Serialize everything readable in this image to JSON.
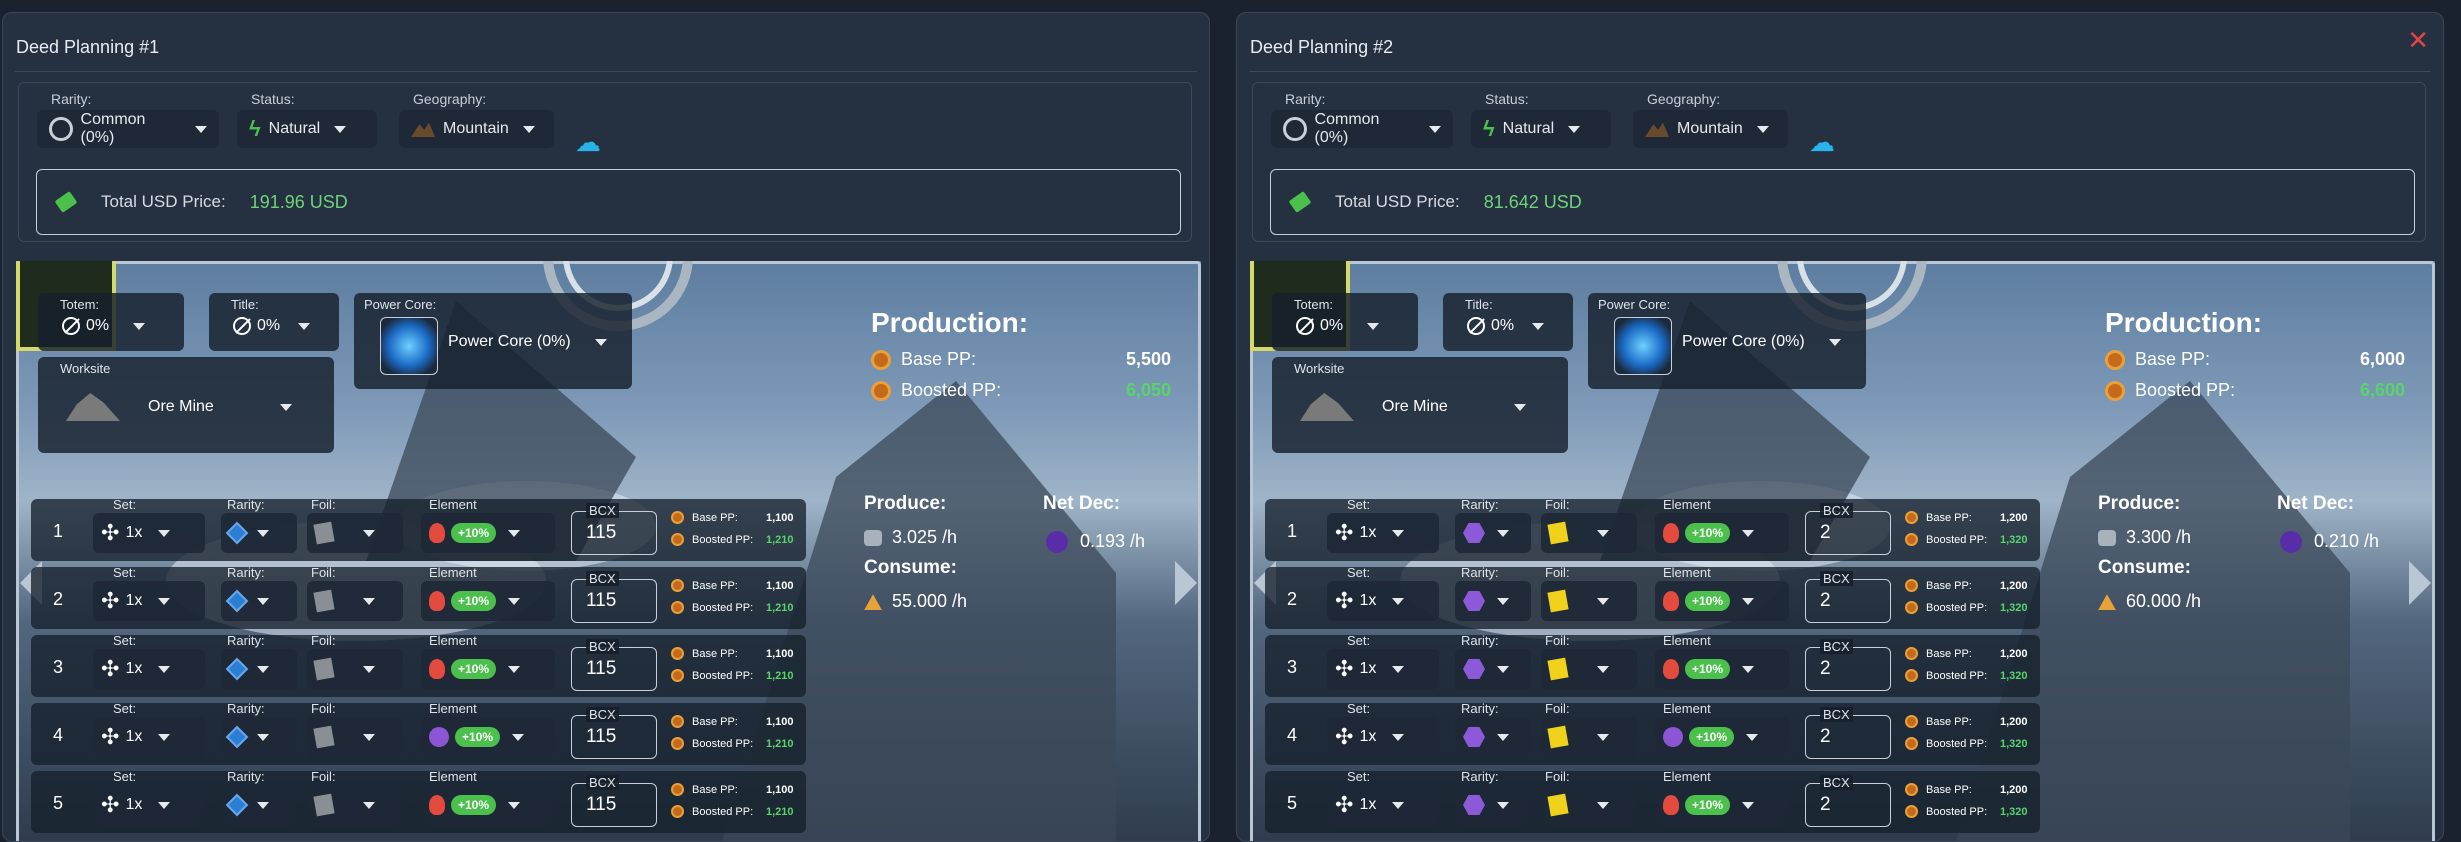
{
  "panels": [
    {
      "title": "Deed Planning #1",
      "show_close": false,
      "filters": {
        "rarity_label": "Rarity:",
        "rarity": "Common (0%)",
        "status_label": "Status:",
        "status": "Natural",
        "geography_label": "Geography:",
        "geography": "Mountain"
      },
      "price": {
        "label": "Total USD Price:",
        "value": "191.96 USD"
      },
      "stats": {
        "totem_label": "Totem:",
        "totem": "0%",
        "title_label": "Title:",
        "title": "0%",
        "power_core_label": "Power Core:",
        "power_core": "Power Core (0%)",
        "worksite_label": "Worksite",
        "worksite": "Ore Mine"
      },
      "production": {
        "title": "Production:",
        "base_label": "Base PP:",
        "base": "5,500",
        "boosted_label": "Boosted PP:",
        "boosted": "6,050"
      },
      "produce": {
        "label": "Produce:",
        "value": "3.025 /h"
      },
      "consume": {
        "label": "Consume:",
        "value": "55.000 /h"
      },
      "netdec": {
        "label": "Net Dec:",
        "value": "0.193 /h"
      },
      "card_labels": {
        "set": "Set:",
        "rarity": "Rarity:",
        "foil": "Foil:",
        "element": "Element",
        "bcx": "BCX",
        "base_pp": "Base PP:",
        "boosted_pp": "Boosted PP:"
      },
      "rows": [
        {
          "n": "1",
          "set": "1x",
          "element_icon": "fire-icon",
          "boost": "+10%",
          "bcx": "115",
          "base": "1,100",
          "boosted": "1,210"
        },
        {
          "n": "2",
          "set": "1x",
          "element_icon": "fire-icon",
          "boost": "+10%",
          "bcx": "115",
          "base": "1,100",
          "boosted": "1,210"
        },
        {
          "n": "3",
          "set": "1x",
          "element_icon": "fire-icon",
          "boost": "+10%",
          "bcx": "115",
          "base": "1,100",
          "boosted": "1,210"
        },
        {
          "n": "4",
          "set": "1x",
          "element_icon": "death-icon",
          "boost": "+10%",
          "bcx": "115",
          "base": "1,100",
          "boosted": "1,210"
        },
        {
          "n": "5",
          "set": "1x",
          "element_icon": "fire-icon",
          "boost": "+10%",
          "bcx": "115",
          "base": "1,100",
          "boosted": "1,210"
        }
      ]
    },
    {
      "title": "Deed Planning #2",
      "show_close": true,
      "close": "✕",
      "filters": {
        "rarity_label": "Rarity:",
        "rarity": "Common (0%)",
        "status_label": "Status:",
        "status": "Natural",
        "geography_label": "Geography:",
        "geography": "Mountain"
      },
      "price": {
        "label": "Total USD Price:",
        "value": "81.642 USD"
      },
      "stats": {
        "totem_label": "Totem:",
        "totem": "0%",
        "title_label": "Title:",
        "title": "0%",
        "power_core_label": "Power Core:",
        "power_core": "Power Core (0%)",
        "worksite_label": "Worksite",
        "worksite": "Ore Mine"
      },
      "production": {
        "title": "Production:",
        "base_label": "Base PP:",
        "base": "6,000",
        "boosted_label": "Boosted PP:",
        "boosted": "6,600"
      },
      "produce": {
        "label": "Produce:",
        "value": "3.300 /h"
      },
      "consume": {
        "label": "Consume:",
        "value": "60.000 /h"
      },
      "netdec": {
        "label": "Net Dec:",
        "value": "0.210 /h"
      },
      "card_labels": {
        "set": "Set:",
        "rarity": "Rarity:",
        "foil": "Foil:",
        "element": "Element",
        "bcx": "BCX",
        "base_pp": "Base PP:",
        "boosted_pp": "Boosted PP:"
      },
      "rows": [
        {
          "n": "1",
          "set": "1x",
          "element_icon": "fire-icon",
          "boost": "+10%",
          "bcx": "2",
          "base": "1,200",
          "boosted": "1,320"
        },
        {
          "n": "2",
          "set": "1x",
          "element_icon": "fire-icon",
          "boost": "+10%",
          "bcx": "2",
          "base": "1,200",
          "boosted": "1,320"
        },
        {
          "n": "3",
          "set": "1x",
          "element_icon": "fire-icon",
          "boost": "+10%",
          "bcx": "2",
          "base": "1,200",
          "boosted": "1,320"
        },
        {
          "n": "4",
          "set": "1x",
          "element_icon": "death-icon",
          "boost": "+10%",
          "bcx": "2",
          "base": "1,200",
          "boosted": "1,320"
        },
        {
          "n": "5",
          "set": "1x",
          "element_icon": "fire-icon",
          "boost": "+10%",
          "bcx": "2",
          "base": "1,200",
          "boosted": "1,320"
        }
      ]
    }
  ],
  "colors": {
    "accent_green": "#58d46b",
    "close_red": "#e04545",
    "cloud_icon": "#28b4e8"
  }
}
